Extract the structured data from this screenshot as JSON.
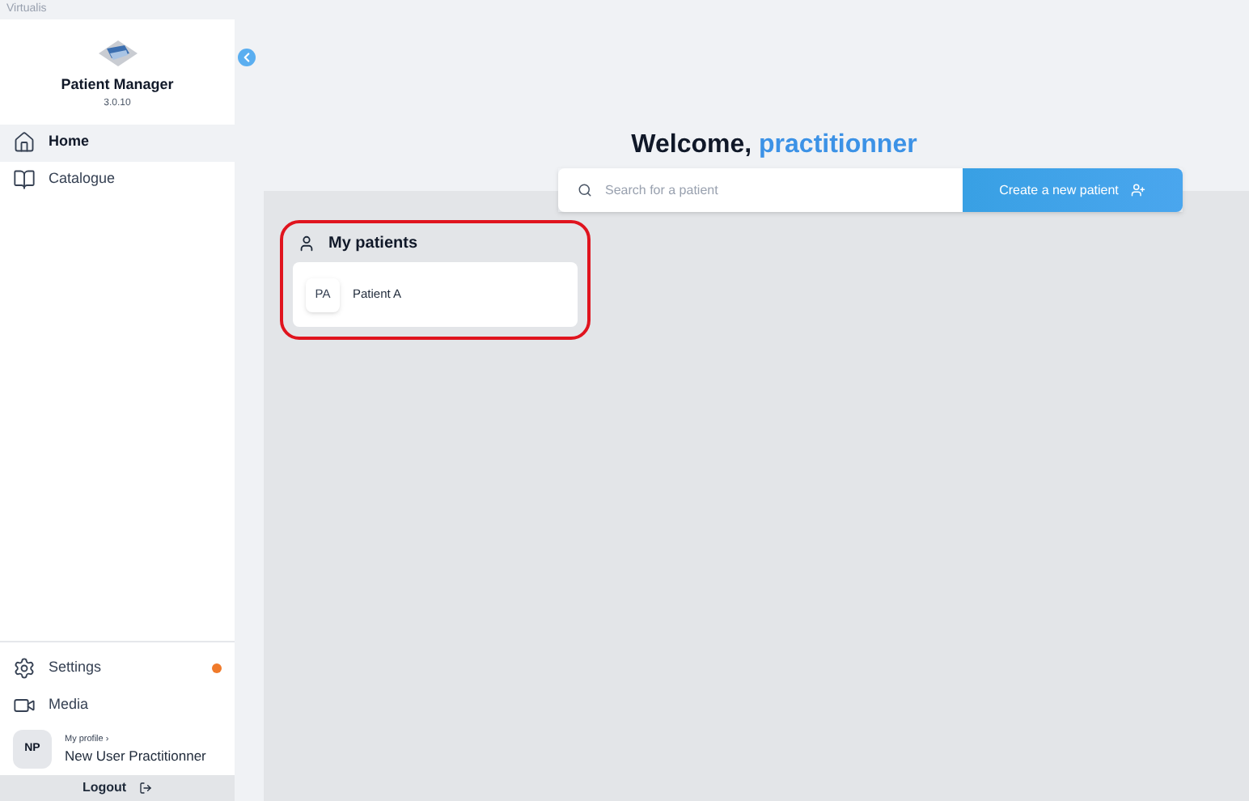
{
  "window": {
    "title": "Virtualis"
  },
  "sidebar": {
    "app_name": "Patient Manager",
    "version": "3.0.10",
    "items": [
      {
        "label": "Home",
        "selected": true
      },
      {
        "label": "Catalogue",
        "selected": false
      }
    ],
    "bottom_items": [
      {
        "label": "Settings",
        "notification": true
      },
      {
        "label": "Media",
        "notification": false
      }
    ],
    "profile": {
      "initials": "NP",
      "link": "My profile ›",
      "name": "New User Practitionner"
    },
    "logout": "Logout"
  },
  "welcome": {
    "greeting": "Welcome,",
    "name": "practitionner"
  },
  "search": {
    "placeholder": "Search for a patient"
  },
  "create_button": "Create a new patient",
  "my_patients": {
    "title": "My patients",
    "highlighted": true,
    "patients": [
      {
        "initials": "PA",
        "name": "Patient A"
      }
    ]
  }
}
